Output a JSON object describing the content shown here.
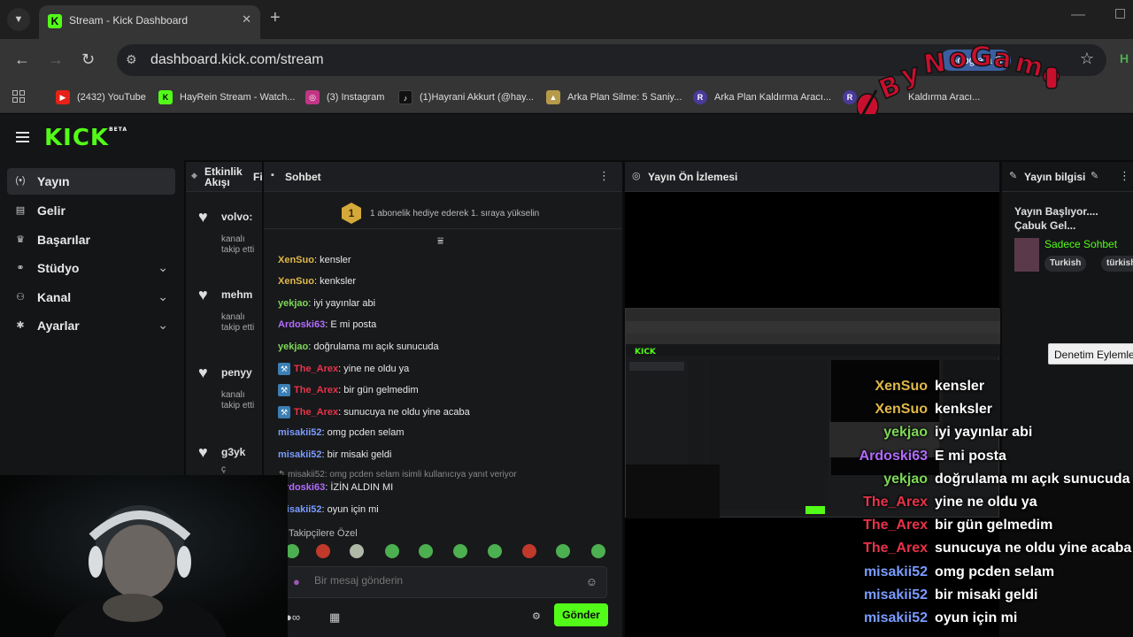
{
  "browser": {
    "tab_title": "Stream - Kick Dashboard",
    "tab_favicon": "K",
    "url": "dashboard.kick.com/stream",
    "google_btn": "Google a S",
    "profile_letter": "H",
    "bookmarks": [
      {
        "label": "(2432) YouTube",
        "icon": "youtube-icon",
        "color": "#e62117"
      },
      {
        "label": "HayRein Stream - Watch...",
        "icon": "kick-icon",
        "color": "#53fc18"
      },
      {
        "label": "(3) Instagram",
        "icon": "instagram-icon",
        "color": "#c13584"
      },
      {
        "label": "(1)Hayrani Akkurt (@hay...",
        "icon": "tiktok-icon",
        "color": "#111111"
      },
      {
        "label": "Arka Plan Silme: 5 Saniy...",
        "icon": "hat-icon",
        "color": "#b59a4a"
      },
      {
        "label": "Arka Plan Kaldırma Aracı...",
        "icon": "r-icon",
        "color": "#4a3a9a"
      },
      {
        "label": "Kaldırma Aracı...",
        "icon": "r-icon",
        "color": "#4a3a9a"
      }
    ]
  },
  "overlay_logo": "ByNoGame",
  "kick": {
    "logo": "KICK",
    "beta": "BETA",
    "sidebar": [
      {
        "label": "Yayın",
        "icon": "broadcast-icon",
        "glyph": "(•)",
        "active": true,
        "chevron": false
      },
      {
        "label": "Gelir",
        "icon": "revenue-icon",
        "glyph": "▤",
        "active": false,
        "chevron": false
      },
      {
        "label": "Başarılar",
        "icon": "trophy-icon",
        "glyph": "♛",
        "active": false,
        "chevron": false
      },
      {
        "label": "Stüdyo",
        "icon": "studio-icon",
        "glyph": "⚭",
        "active": false,
        "chevron": true
      },
      {
        "label": "Kanal",
        "icon": "channel-icon",
        "glyph": "⚇",
        "active": false,
        "chevron": true
      },
      {
        "label": "Ayarlar",
        "icon": "settings-icon",
        "glyph": "✱",
        "active": false,
        "chevron": true
      }
    ]
  },
  "activity": {
    "title": "Etkinlik Akışı",
    "cut_label": "Fi",
    "items": [
      {
        "name": "volvo:",
        "sub": "kanalı takip etti"
      },
      {
        "name": "mehm",
        "sub": "kanalı takip etti"
      },
      {
        "name": "penyy",
        "sub": "kanalı takip etti"
      },
      {
        "name": "g3yk",
        "sub": "ç"
      }
    ]
  },
  "chat": {
    "title": "Sohbet",
    "pin_rank": "1",
    "pin_text": "1 abonelik hediye ederek 1. sıraya yükselin",
    "messages": [
      {
        "user": "XenSuo",
        "text": "kensler",
        "color": "#e0b84a",
        "badge": false
      },
      {
        "user": "XenSuo",
        "text": "kenksler",
        "color": "#e0b84a",
        "badge": false
      },
      {
        "user": "yekjao",
        "text": "iyi yayınlar abi",
        "color": "#7ed957",
        "badge": false
      },
      {
        "user": "Ardoski63",
        "text": "E mi posta",
        "color": "#b36bff",
        "badge": false
      },
      {
        "user": "yekjao",
        "text": "doğrulama mı açık sunucuda",
        "color": "#7ed957",
        "badge": false
      },
      {
        "user": "The_Arex",
        "text": "yine ne oldu ya",
        "color": "#e8334a",
        "badge": true
      },
      {
        "user": "The_Arex",
        "text": "bir gün gelmedim",
        "color": "#e8334a",
        "badge": true
      },
      {
        "user": "The_Arex",
        "text": "sunucuya ne oldu yine acaba",
        "color": "#e8334a",
        "badge": true
      },
      {
        "user": "misakii52",
        "text": "omg pcden selam",
        "color": "#7a9cff",
        "badge": false
      },
      {
        "user": "misakii52",
        "text": "bir misaki geldi",
        "color": "#7a9cff",
        "badge": false
      }
    ],
    "reply_hint": "↰ misakii52: omg pcden selam isimli kullanıcıya yanıt veriyor",
    "reply_msg": {
      "user": "Ardoski63",
      "text": "İZİN ALDIN MI",
      "color": "#b36bff"
    },
    "last_msg": {
      "user": "misakii52",
      "text": "oyun için mi",
      "color": "#7a9cff"
    },
    "followers_only": "Takipçilere Özel",
    "placeholder": "Bir mesaj gönderin",
    "send_label": "Gönder"
  },
  "preview": {
    "title": "Yayın Ön İzlemesi"
  },
  "stream_info": {
    "title": "Yayın bilgisi",
    "stream_title": "Yayın Başlıyor.... Çabuk Gel...",
    "category": "Sadece Sohbet",
    "tags": [
      "Turkish",
      "türkish"
    ]
  },
  "tooltip": "Denetim Eylemle",
  "overlay_chat": [
    {
      "user": "XenSuo",
      "text": "kensler",
      "color": "#e0b84a"
    },
    {
      "user": "XenSuo",
      "text": "kenksler",
      "color": "#e0b84a"
    },
    {
      "user": "yekjao",
      "text": "iyi yayınlar abi",
      "color": "#7ed957"
    },
    {
      "user": "Ardoski63",
      "text": "E mi posta",
      "color": "#b36bff"
    },
    {
      "user": "yekjao",
      "text": "doğrulama mı açık sunucuda",
      "color": "#7ed957"
    },
    {
      "user": "The_Arex",
      "text": "yine ne oldu ya",
      "color": "#e8334a"
    },
    {
      "user": "The_Arex",
      "text": "bir gün gelmedim",
      "color": "#e8334a"
    },
    {
      "user": "The_Arex",
      "text": "sunucuya ne oldu yine acaba",
      "color": "#e8334a"
    },
    {
      "user": "misakii52",
      "text": "omg pcden selam",
      "color": "#7a9cff"
    },
    {
      "user": "misakii52",
      "text": "bir misaki geldi",
      "color": "#7a9cff"
    },
    {
      "user": "misakii52",
      "text": "oyun için mi",
      "color": "#7a9cff"
    }
  ]
}
